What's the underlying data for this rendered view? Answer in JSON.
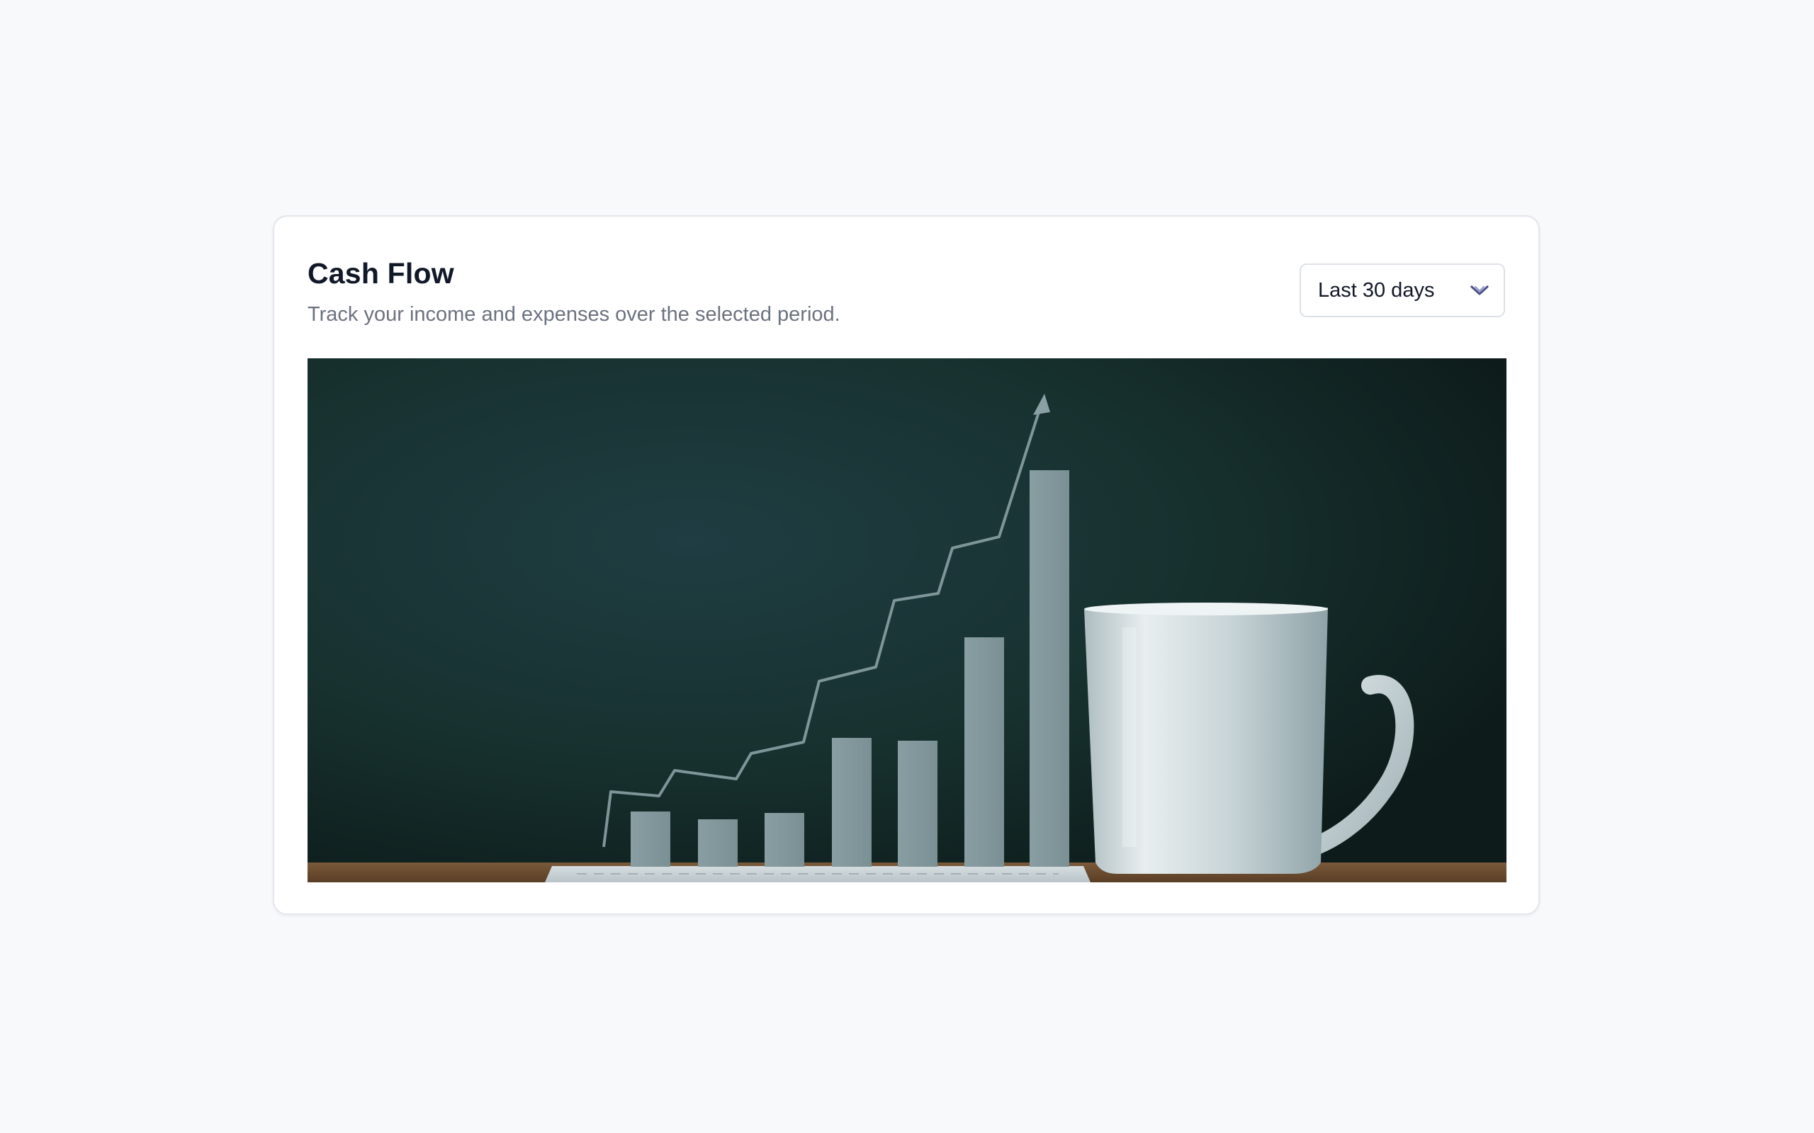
{
  "card": {
    "title": "Cash Flow",
    "subtitle": "Track your income and expenses over the selected period."
  },
  "period_select": {
    "selected": "Last 30 days",
    "icon": "chevron-down-icon"
  },
  "hero_image": {
    "icon": "growth-chart-with-coffee-mug-photo"
  },
  "colors": {
    "background": "#f8f9fb",
    "card": "#ffffff",
    "title": "#111827",
    "subtitle": "#6b7280",
    "border": "#e3e6ea",
    "photo_background": "#14292c",
    "photo_bars": "#7f9599"
  }
}
